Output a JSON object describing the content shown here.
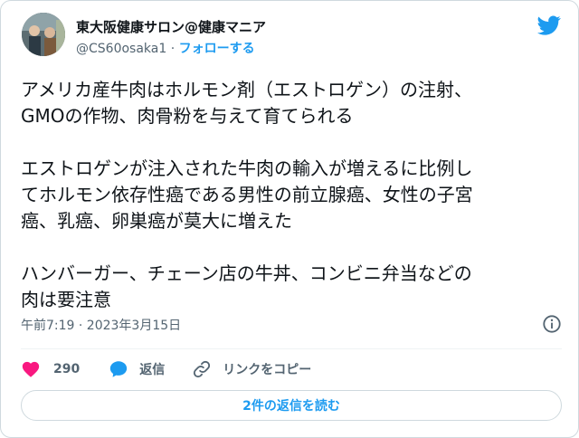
{
  "user": {
    "display_name": "東大阪健康サロン@健康マニア",
    "handle": "@CS60osaka1",
    "separator": " · ",
    "follow_label": "フォローする",
    "avatar_icon": "user-avatar-photo"
  },
  "brand": {
    "icon": "twitter-bird-icon",
    "color": "#1d9bf0"
  },
  "tweet": {
    "text": "アメリカ産牛肉はホルモン剤（エストロゲン）の注射、\nGMOの作物、肉骨粉を与えて育てられる\n\nエストロゲンが注入された牛肉の輸入が増えるに比例し\nてホルモン依存性癌である男性の前立腺癌、女性の子宮\n癌、乳癌、卵巣癌が莫大に増えた\n\nハンバーガー、チェーン店の牛丼、コンビニ弁当などの\n肉は要注意",
    "timestamp": "午前7:19 · 2023年3月15日",
    "info_icon": "info-icon"
  },
  "actions": {
    "like_count": "290",
    "like_icon": "heart-icon",
    "like_color": "#f91880",
    "reply_label": "返信",
    "reply_icon": "speech-bubble-icon",
    "copy_label": "リンクをコピー",
    "copy_icon": "link-icon"
  },
  "footer": {
    "read_replies_label": "2件の返信を読む"
  }
}
